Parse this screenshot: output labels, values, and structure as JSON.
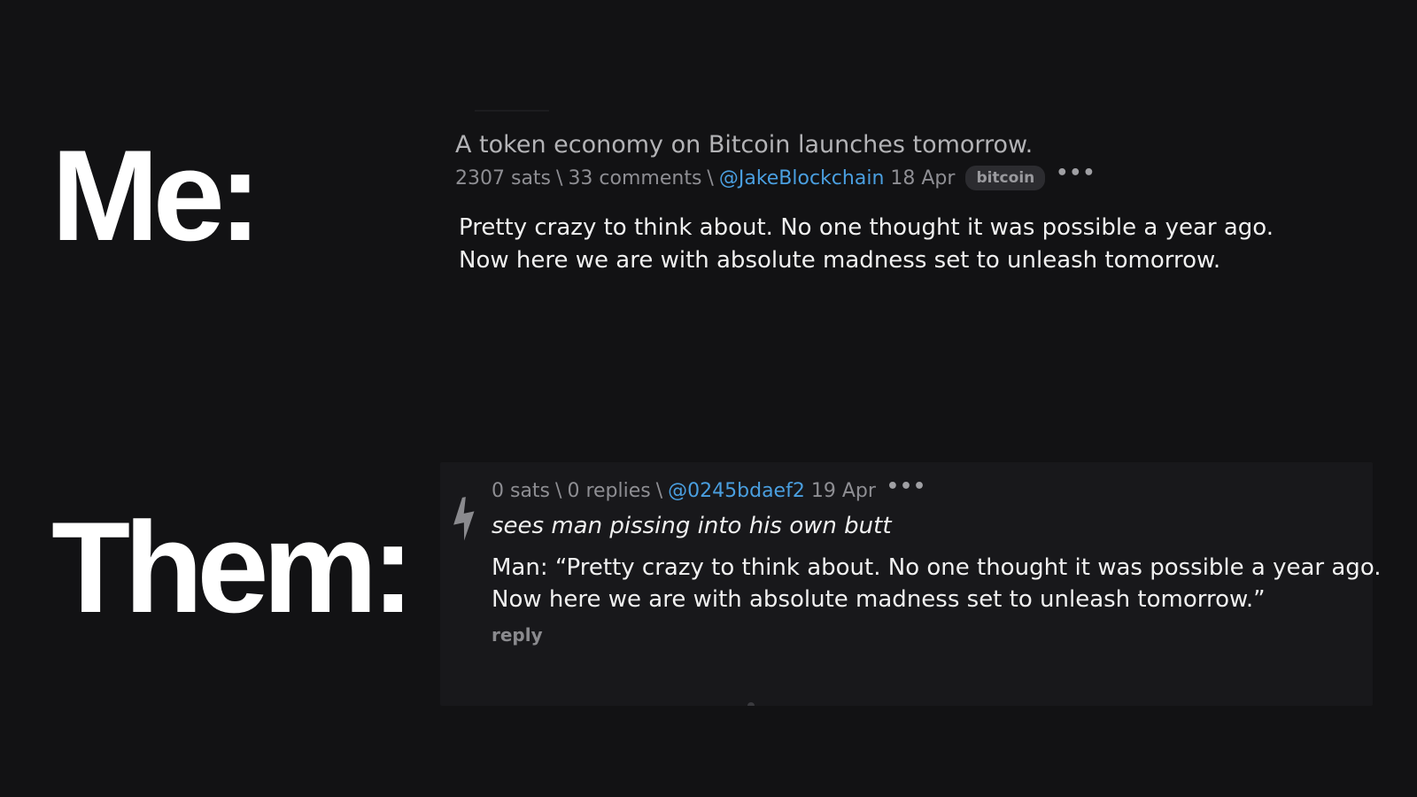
{
  "labels": {
    "me": "Me:",
    "them": "Them:"
  },
  "post": {
    "title": "A token economy on Bitcoin launches tomorrow.",
    "sats": "2307 sats",
    "comments": "33 comments",
    "separator": "\\",
    "user": "@JakeBlockchain",
    "date": "18 Apr",
    "tag": "bitcoin",
    "more": "•••",
    "body_line1": "Pretty crazy to think about. No one thought it was possible a year ago.",
    "body_line2": "Now here we are with absolute madness set to unleash tomorrow."
  },
  "comment": {
    "sats": "0 sats",
    "replies": "0 replies",
    "separator": "\\",
    "user": "@0245bdaef2",
    "date": "19 Apr",
    "more": "•••",
    "title": "sees man pissing into his own butt",
    "body_line1": "Man: “Pretty crazy to think about. No one thought it was possible a year ago.",
    "body_line2": "Now here we are with absolute madness set to unleash tomorrow.”",
    "reply_label": "reply",
    "icon": "lightning-bolt-icon"
  },
  "colors": {
    "background": "#121214",
    "link": "#4a9fe0",
    "muted": "#8e8e93",
    "badge_bg": "#2c2c30"
  }
}
